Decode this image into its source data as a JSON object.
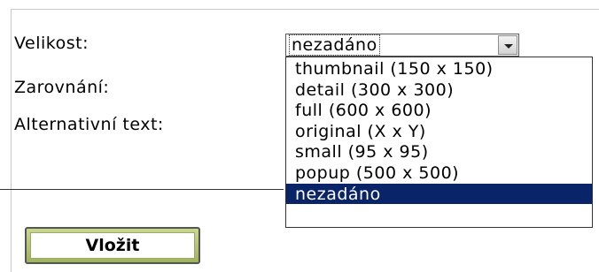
{
  "form": {
    "size_label": "Velikost:",
    "align_label": "Zarovnání:",
    "alt_label": "Alternativní text:",
    "size_select": {
      "value": "nezadáno",
      "options": [
        "thumbnail (150 x 150)",
        "detail (300 x 300)",
        "full (600 x 600)",
        "original (X x Y)",
        "small (95 x 95)",
        "popup (500 x 500)",
        "nezadáno"
      ],
      "highlighted_index": 6
    },
    "insert_label": "Vložit"
  },
  "colors": {
    "highlight": "#0a246a",
    "button_green": "#9fb45a"
  }
}
